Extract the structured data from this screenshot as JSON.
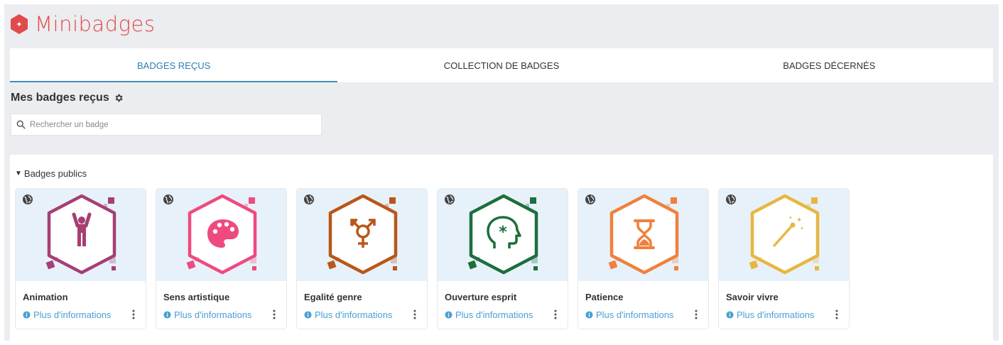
{
  "brand": {
    "name": "Minibadges",
    "color": "#e04a4a",
    "logo_icon": "hexagon-stars-icon"
  },
  "tabs": [
    {
      "label": "BADGES REÇUS",
      "active": true
    },
    {
      "label": "COLLECTION DE BADGES",
      "active": false
    },
    {
      "label": "BADGES DÉCERNÉS",
      "active": false
    }
  ],
  "section": {
    "title": "Mes badges reçus",
    "settings_icon": "gear-icon"
  },
  "search": {
    "placeholder": "Rechercher un badge",
    "value": ""
  },
  "group": {
    "label": "Badges publics",
    "expanded": true
  },
  "badges": [
    {
      "name": "Animation",
      "color": "#a63f73",
      "icon": "person-arms-up-icon",
      "visibility": "public",
      "more_label": "Plus d'informations"
    },
    {
      "name": "Sens artistique",
      "color": "#ef4a7f",
      "icon": "palette-icon",
      "visibility": "public",
      "more_label": "Plus d'informations"
    },
    {
      "name": "Egalité genre",
      "color": "#b8571a",
      "icon": "gender-symbol-icon",
      "visibility": "public",
      "more_label": "Plus d'informations"
    },
    {
      "name": "Ouverture esprit",
      "color": "#1d6e3d",
      "icon": "head-asterisk-icon",
      "visibility": "public",
      "more_label": "Plus d'informations"
    },
    {
      "name": "Patience",
      "color": "#f0803c",
      "icon": "hourglass-icon",
      "visibility": "public",
      "more_label": "Plus d'informations"
    },
    {
      "name": "Savoir vivre",
      "color": "#e8b640",
      "icon": "magic-wand-icon",
      "visibility": "public",
      "more_label": "Plus d'informations"
    }
  ],
  "colors": {
    "accent": "#2e7db6",
    "link": "#4a9fd4",
    "card_image_bg": "#e7f1fa",
    "page_bg": "#ecedf0"
  }
}
